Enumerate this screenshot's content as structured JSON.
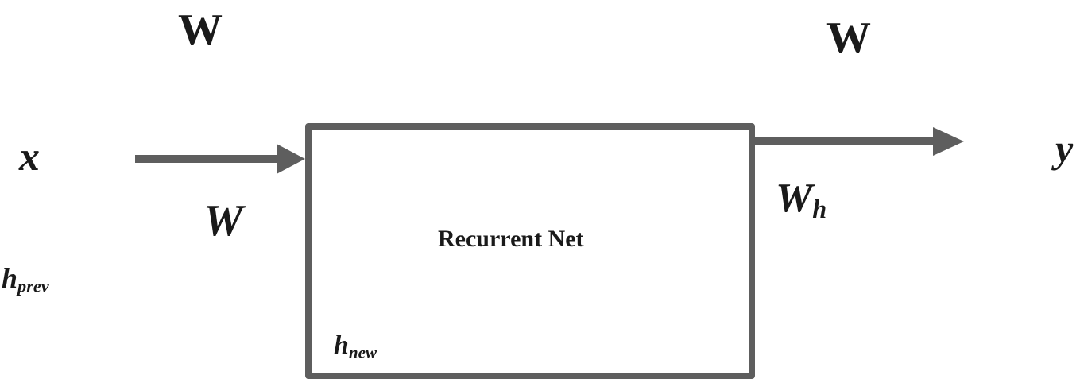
{
  "diagram": {
    "box_label": "Recurrent Net",
    "input_label": "x",
    "output_label": "y",
    "top_left_weight": "W",
    "top_right_weight": "W",
    "input_weight": "W",
    "output_weight": {
      "base": "W",
      "sub": "h"
    },
    "prev_hidden": {
      "base": "h",
      "sub": "prev"
    },
    "new_hidden": {
      "base": "h",
      "sub": "new"
    },
    "colors": {
      "stroke": "#5e5e5e",
      "text": "#1a1a1a",
      "background": "#ffffff"
    }
  }
}
